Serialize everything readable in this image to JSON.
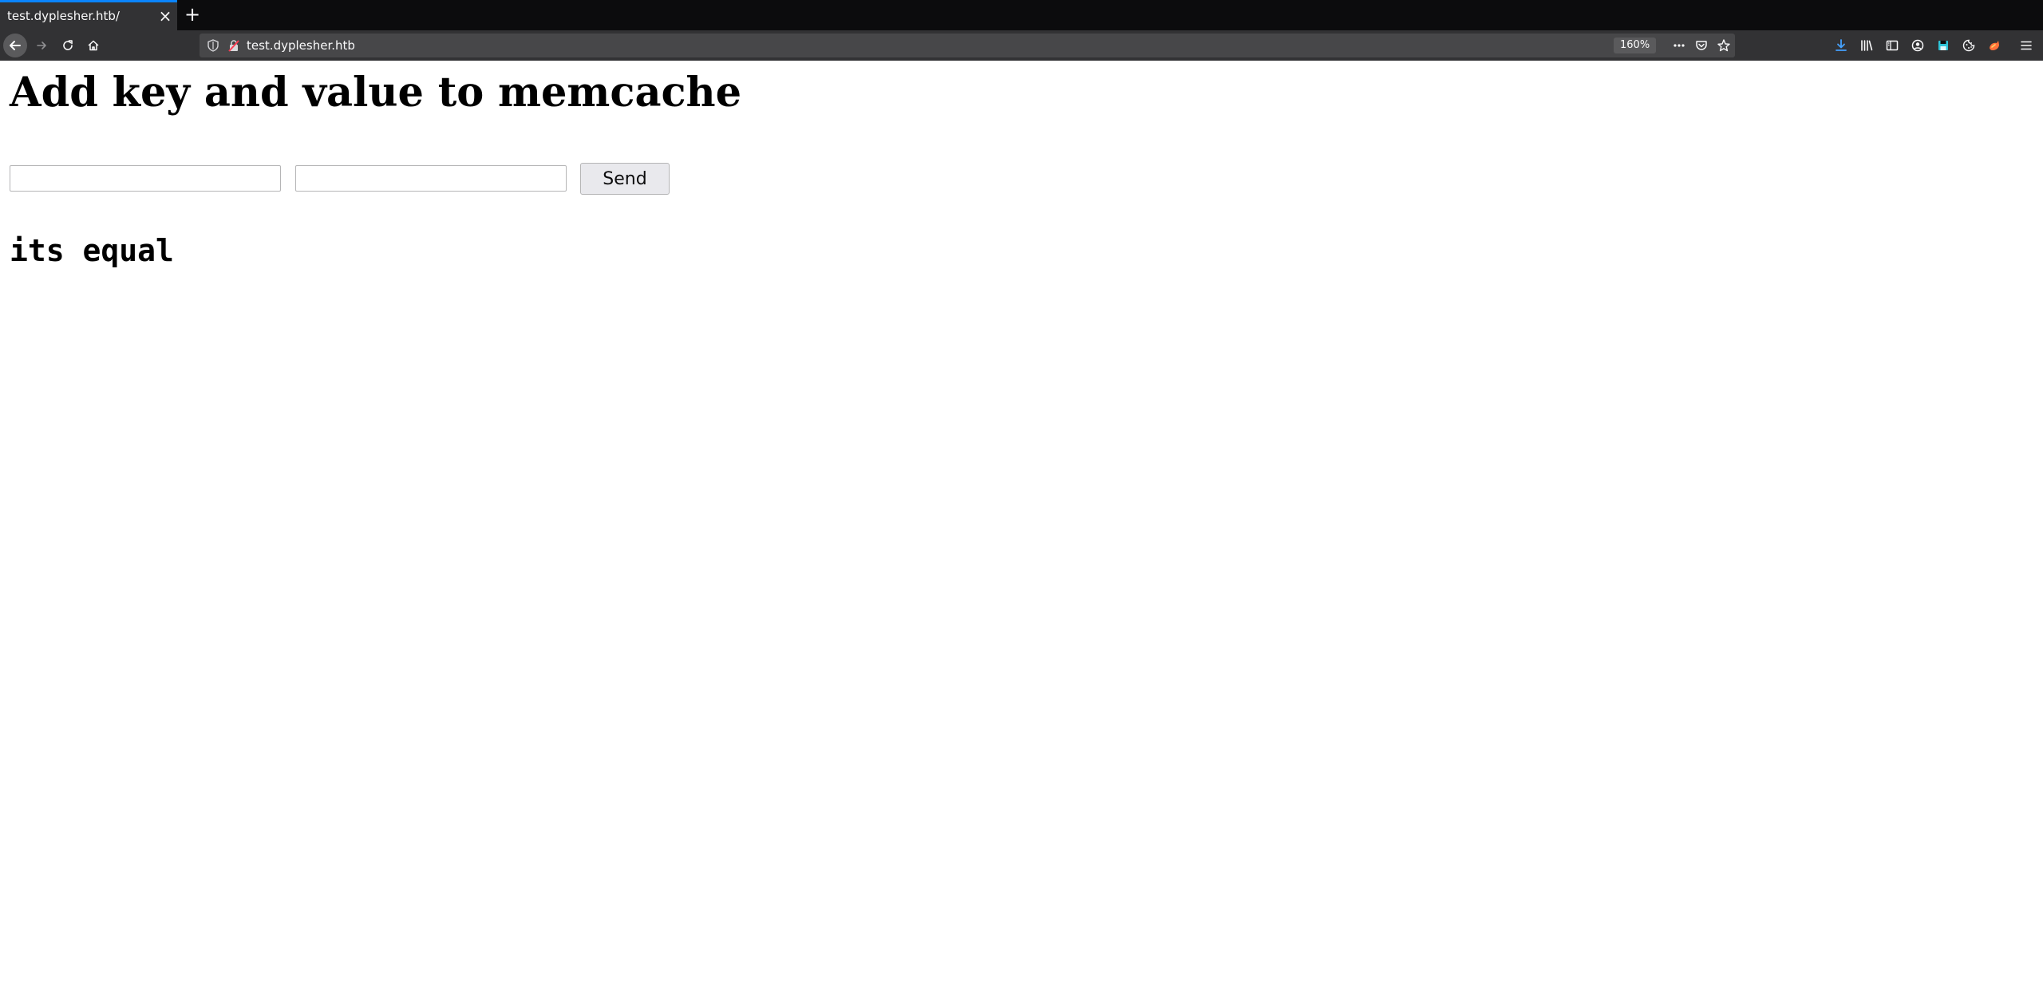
{
  "browser": {
    "tab": {
      "title": "test.dyplesher.htb/",
      "close_icon": "close-icon"
    },
    "new_tab_icon": "plus-icon",
    "nav": {
      "back_icon": "arrow-left-icon",
      "forward_icon": "arrow-right-icon",
      "reload_icon": "reload-icon",
      "home_icon": "home-icon"
    },
    "urlbar": {
      "url": "test.dyplesher.htb",
      "zoom": "160%",
      "shield_icon": "shield-icon",
      "insecure_icon": "insecure-lock-icon",
      "page_actions_icon": "ellipsis-icon",
      "pocket_icon": "pocket-icon",
      "bookmark_icon": "star-icon"
    },
    "toolbar_icons": [
      "download-icon",
      "library-icon",
      "sidebar-icon",
      "account-icon",
      "save-icon",
      "cookie-icon",
      "extension-icon",
      "menu-icon"
    ],
    "colors": {
      "chrome_dark": "#0c0c0d",
      "toolbar": "#323234",
      "urlbar": "#474749",
      "tab_accent": "#0a84ff",
      "download_accent": "#45a1ff"
    }
  },
  "page": {
    "heading": "Add key and value to memcache",
    "key_input": {
      "value": "",
      "placeholder": ""
    },
    "value_input": {
      "value": "",
      "placeholder": ""
    },
    "send_label": "Send",
    "result": "its equal"
  }
}
